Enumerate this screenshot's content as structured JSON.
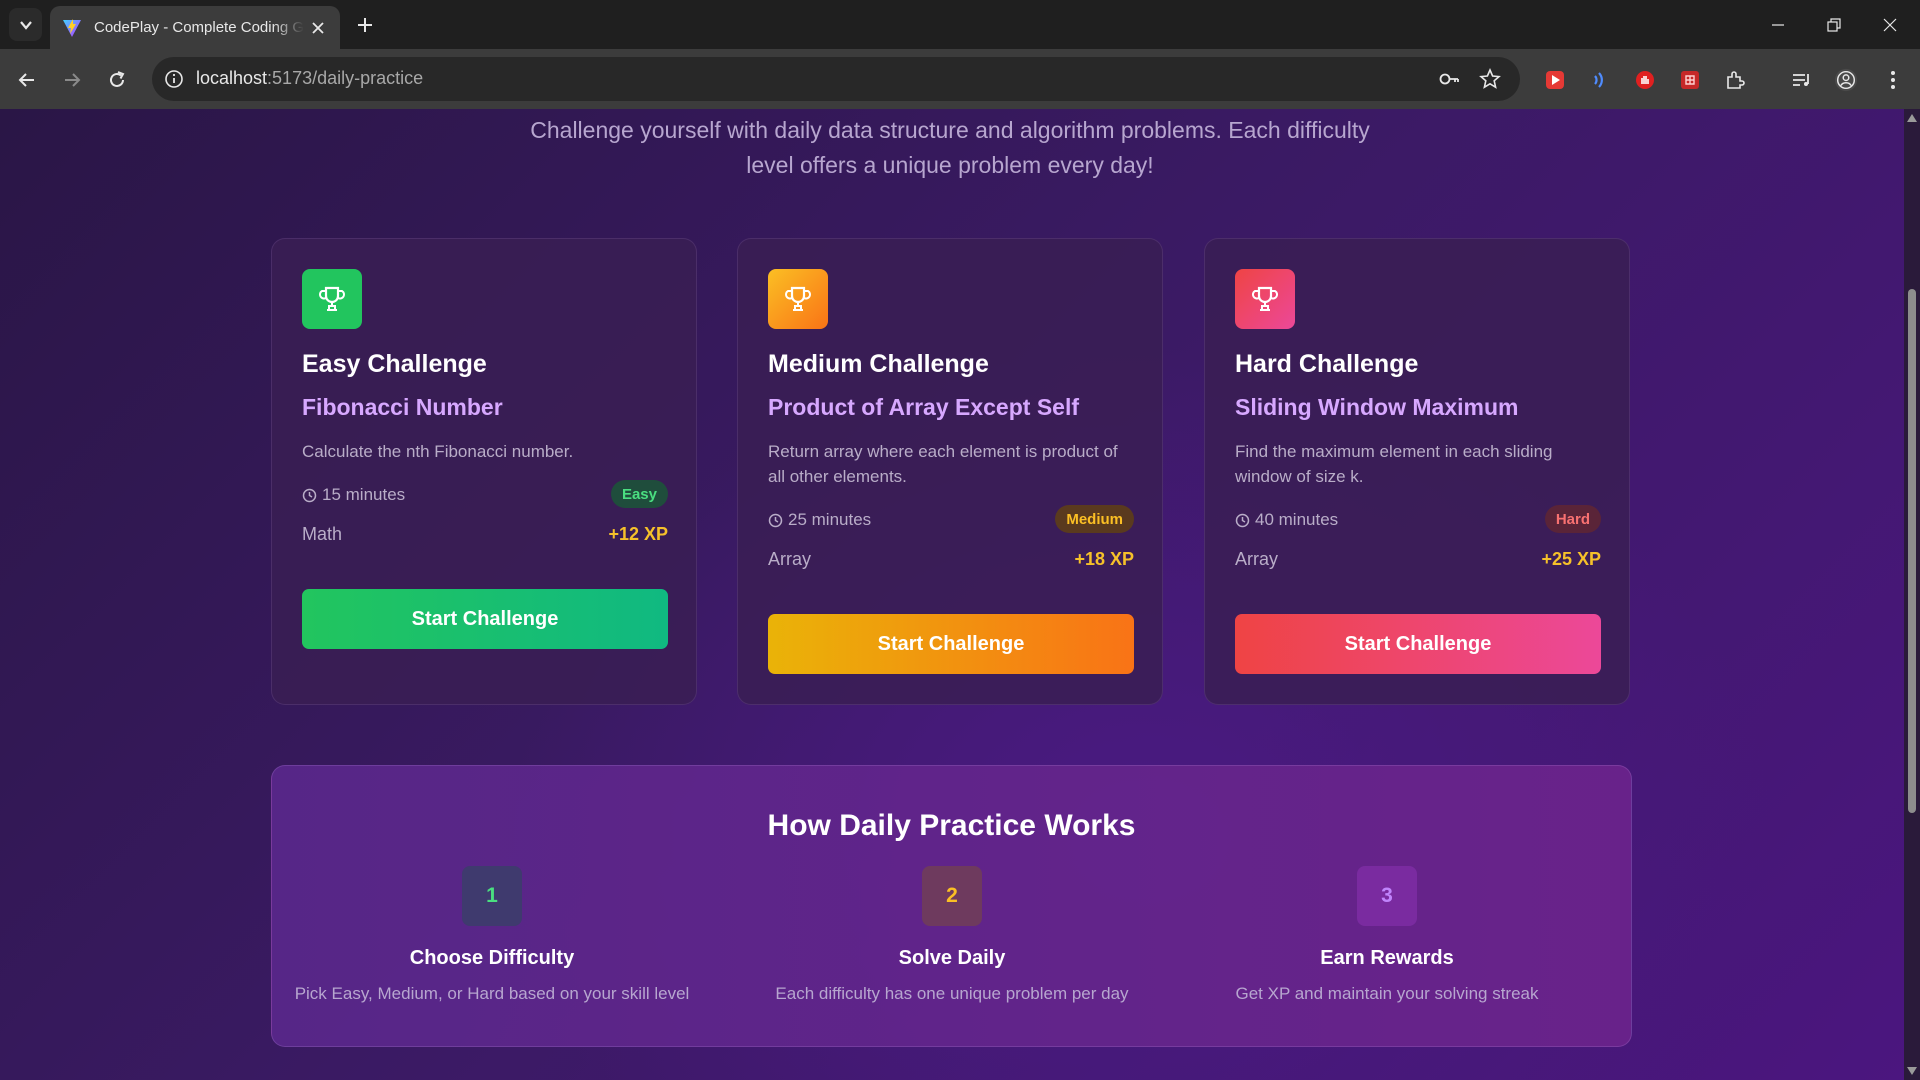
{
  "browser": {
    "tab_title": "CodePlay - Complete Coding Game Platform",
    "url_host": "localhost",
    "url_path": ":5173/daily-practice"
  },
  "page": {
    "intro_line1": "Challenge yourself with daily data structure and algorithm problems. Each difficulty",
    "intro_line2": "level offers a unique problem every day!",
    "cards": [
      {
        "heading": "Easy Challenge",
        "problem": "Fibonacci Number",
        "description": "Calculate the nth Fibonacci number.",
        "time": "15 minutes",
        "badge": "Easy",
        "category": "Math",
        "xp": "+12 XP",
        "button": "Start Challenge",
        "accent": "#22c55e"
      },
      {
        "heading": "Medium Challenge",
        "problem": "Product of Array Except Self",
        "description": "Return array where each element is product of all other elements.",
        "time": "25 minutes",
        "badge": "Medium",
        "category": "Array",
        "xp": "+18 XP",
        "button": "Start Challenge",
        "accent": "#f59e0b"
      },
      {
        "heading": "Hard Challenge",
        "problem": "Sliding Window Maximum",
        "description": "Find the maximum element in each sliding window of size k.",
        "time": "40 minutes",
        "badge": "Hard",
        "category": "Array",
        "xp": "+25 XP",
        "button": "Start Challenge",
        "accent": "#ef4444"
      }
    ],
    "how": {
      "title": "How Daily Practice Works",
      "steps": [
        {
          "num": "1",
          "title": "Choose Difficulty",
          "desc": "Pick Easy, Medium, or Hard based on your skill level"
        },
        {
          "num": "2",
          "title": "Solve Daily",
          "desc": "Each difficulty has one unique problem per day"
        },
        {
          "num": "3",
          "title": "Earn Rewards",
          "desc": "Get XP and maintain your solving streak"
        }
      ]
    }
  }
}
